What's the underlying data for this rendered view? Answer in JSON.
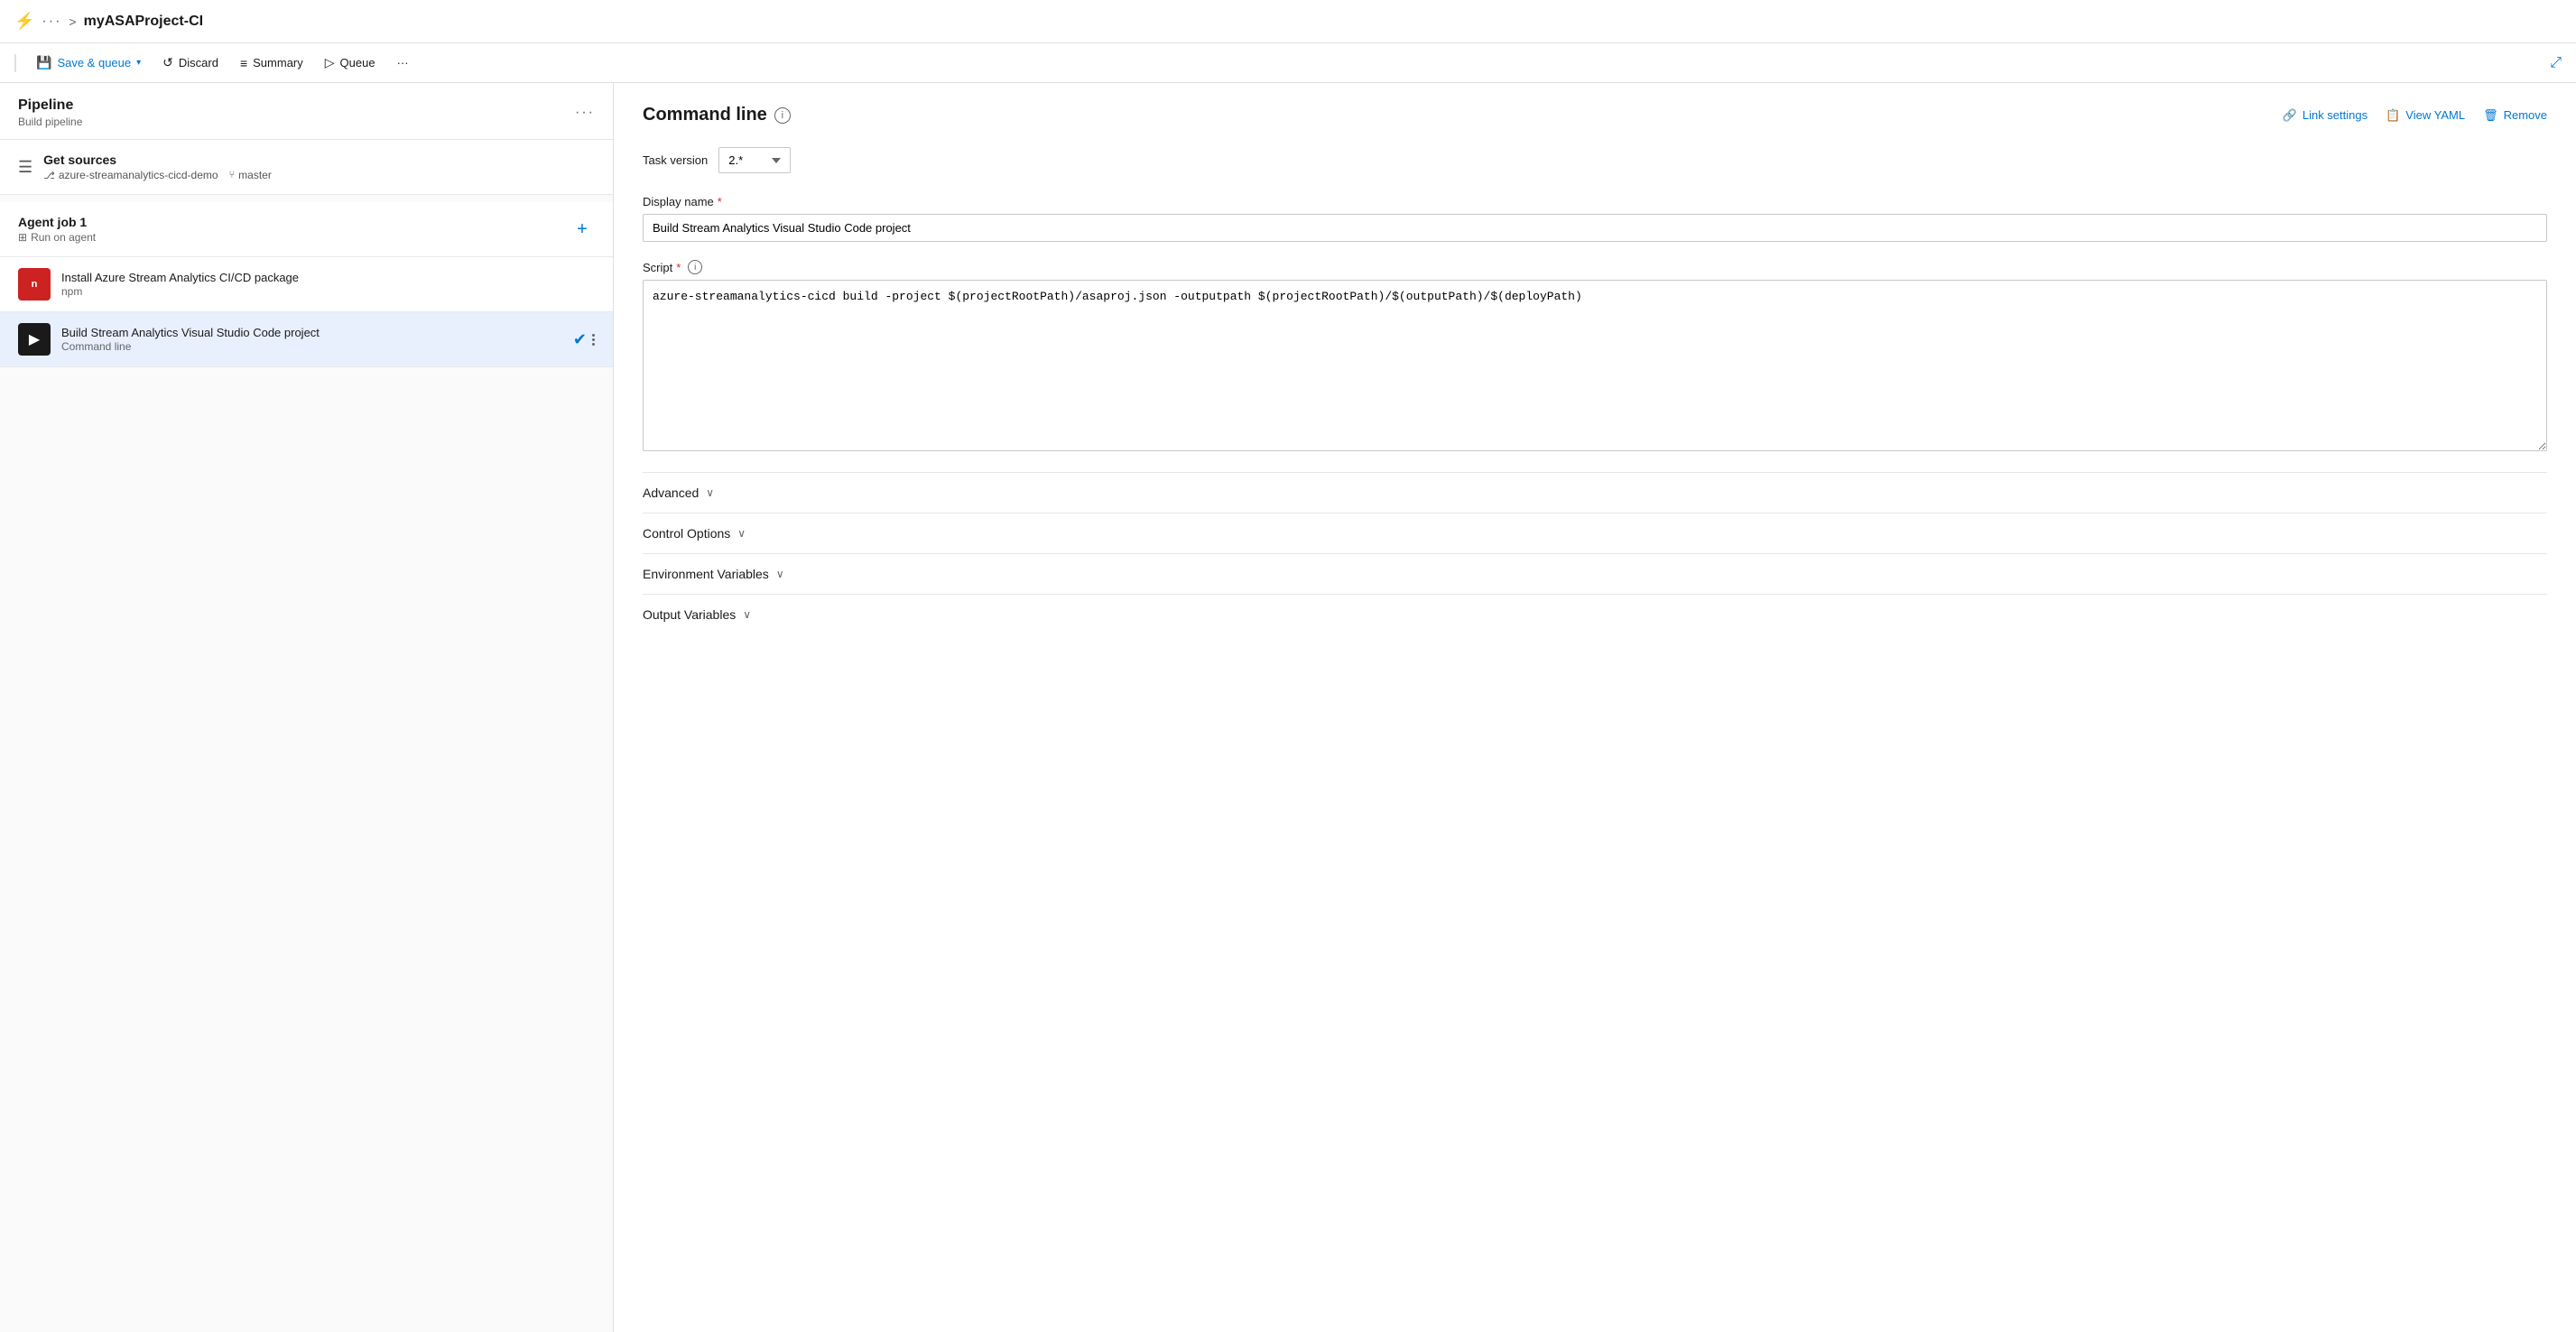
{
  "topbar": {
    "icon": "⚡",
    "dots": "···",
    "chevron": ">",
    "title": "myASAProject-CI"
  },
  "toolbar": {
    "save_queue_label": "Save & queue",
    "save_chevron": "▾",
    "discard_label": "Discard",
    "summary_label": "Summary",
    "queue_label": "Queue",
    "more_dots": "···",
    "expand_icon": "⤢"
  },
  "left_panel": {
    "pipeline_title": "Pipeline",
    "pipeline_subtitle": "Build pipeline",
    "more_dots": "···",
    "get_sources": {
      "title": "Get sources",
      "repo": "azure-streamanalytics-cicd-demo",
      "branch": "master"
    },
    "agent_job": {
      "title": "Agent job 1",
      "subtitle": "Run on agent",
      "add_icon": "+"
    },
    "tasks": [
      {
        "id": "task-npm",
        "icon_type": "npm",
        "icon_label": "n",
        "name": "Install Azure Stream Analytics CI/CD package",
        "subtitle": "npm",
        "active": false
      },
      {
        "id": "task-cmd",
        "icon_type": "cmd",
        "icon_label": ">_",
        "name": "Build Stream Analytics Visual Studio Code project",
        "subtitle": "Command line",
        "active": true
      }
    ]
  },
  "right_panel": {
    "title": "Command line",
    "info_icon": "i",
    "link_settings_label": "Link settings",
    "view_yaml_label": "View YAML",
    "remove_label": "Remove",
    "task_version_label": "Task version",
    "task_version_value": "2.*",
    "display_name_label": "Display name",
    "required_star": "*",
    "display_name_value": "Build Stream Analytics Visual Studio Code project",
    "script_label": "Script",
    "script_info": "i",
    "script_value": "azure-streamanalytics-cicd build -project $(projectRootPath)/asaproj.json -outputpath $(projectRootPath)/$(outputPath)/$(deployPath)",
    "sections": [
      {
        "id": "advanced",
        "label": "Advanced",
        "chevron": "∨"
      },
      {
        "id": "control-options",
        "label": "Control Options",
        "chevron": "∨"
      },
      {
        "id": "environment-variables",
        "label": "Environment Variables",
        "chevron": "∨"
      },
      {
        "id": "output-variables",
        "label": "Output Variables",
        "chevron": "∨"
      }
    ]
  }
}
